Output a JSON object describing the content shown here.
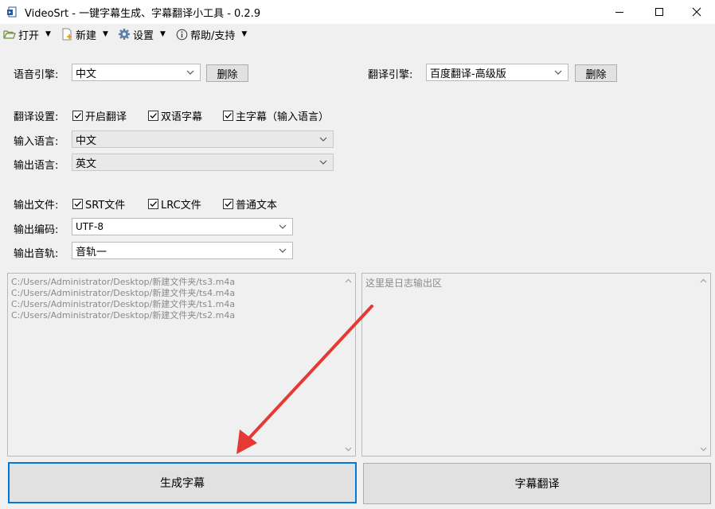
{
  "window": {
    "title": "VideoSrt - 一键字幕生成、字幕翻译小工具 - 0.2.9"
  },
  "menubar": {
    "open": "打开",
    "new": "新建",
    "settings": "设置",
    "help": "帮助/支持"
  },
  "speech_engine": {
    "label": "语音引擎:",
    "value": "中文",
    "delete_label": "删除"
  },
  "translate_engine": {
    "label": "翻译引擎:",
    "value": "百度翻译-高级版",
    "delete_label": "删除"
  },
  "translate_settings": {
    "label": "翻译设置:",
    "options": [
      {
        "label": "开启翻译",
        "checked": true
      },
      {
        "label": "双语字幕",
        "checked": true
      },
      {
        "label": "主字幕（输入语言）",
        "checked": true
      }
    ]
  },
  "input_language": {
    "label": "输入语言:",
    "value": "中文"
  },
  "output_language": {
    "label": "输出语言:",
    "value": "英文"
  },
  "output_files": {
    "label": "输出文件:",
    "options": [
      {
        "label": "SRT文件",
        "checked": true
      },
      {
        "label": "LRC文件",
        "checked": true
      },
      {
        "label": "普通文本",
        "checked": true
      }
    ]
  },
  "output_encoding": {
    "label": "输出编码:",
    "value": "UTF-8"
  },
  "output_track": {
    "label": "输出音轨:",
    "value": "音轨一"
  },
  "file_list": [
    "C:/Users/Administrator/Desktop/新建文件夹/ts3.m4a",
    "C:/Users/Administrator/Desktop/新建文件夹/ts4.m4a",
    "C:/Users/Administrator/Desktop/新建文件夹/ts1.m4a",
    "C:/Users/Administrator/Desktop/新建文件夹/ts2.m4a"
  ],
  "log": {
    "placeholder": "这里是日志输出区"
  },
  "actions": {
    "generate": "生成字幕",
    "translate": "字幕翻译"
  },
  "icons": {
    "app": "video-doc-icon",
    "open": "folder-open-icon",
    "new": "new-file-icon",
    "settings": "gear-icon",
    "help": "info-icon"
  },
  "colors": {
    "accent": "#0078d7",
    "annotation_arrow": "#e53935"
  }
}
